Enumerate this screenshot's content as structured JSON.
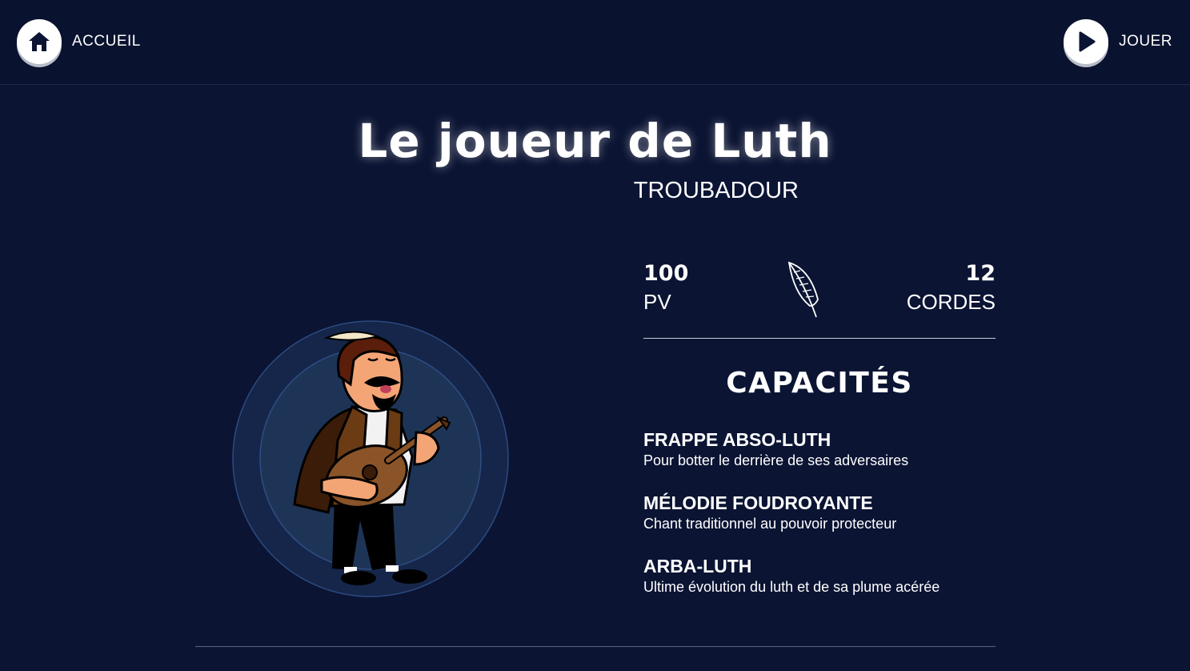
{
  "nav": {
    "home_label": "ACCUEIL",
    "home_icon": "home-icon",
    "play_label": "JOUER",
    "play_icon": "play-icon"
  },
  "character": {
    "name": "Le joueur de Luth",
    "class": "TROUBADOUR",
    "portrait_icon": "lute-player-portrait"
  },
  "stats": {
    "hp_value": "100",
    "hp_label": "PV",
    "strings_value": "12",
    "strings_label": "CORDES",
    "divider_icon": "feather-icon"
  },
  "abilities": {
    "title": "CAPACITÉS",
    "items": [
      {
        "name": "FRAPPE ABSO-LUTH",
        "description": "Pour botter le derrière de ses adversaires"
      },
      {
        "name": "MÉLODIE FOUDROYANTE",
        "description": "Chant traditionnel au pouvoir protecteur"
      },
      {
        "name": "ARBA-LUTH",
        "description": "Ultime évolution du luth et de sa plume acérée"
      }
    ]
  },
  "colors": {
    "background": "#0b1433",
    "topbar": "#09122e",
    "text": "#ffffff",
    "portrait_ring_outer": "#182a50",
    "portrait_ring_inner": "#1f3558"
  }
}
